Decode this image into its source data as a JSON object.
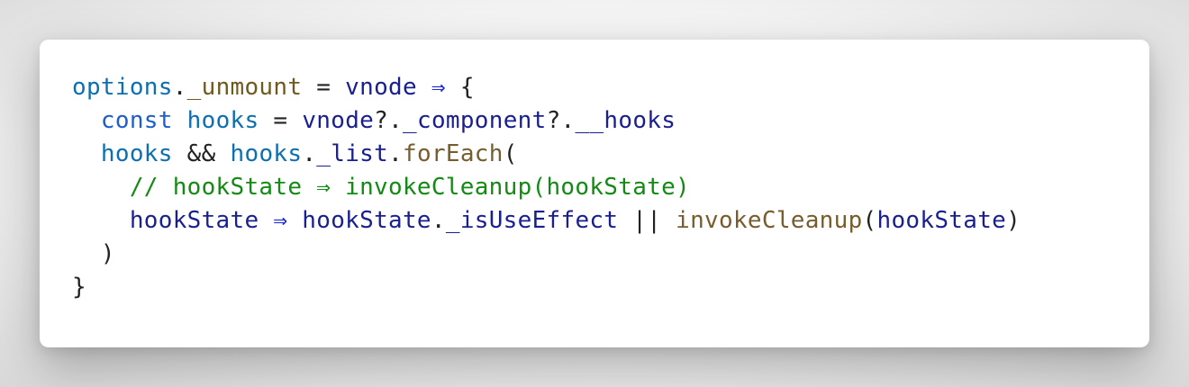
{
  "code": {
    "lines": [
      [
        {
          "text": "options",
          "kind": "var"
        },
        {
          "text": ".",
          "kind": "punct"
        },
        {
          "text": "_unmount",
          "kind": "prop"
        },
        {
          "text": " = ",
          "kind": "punct"
        },
        {
          "text": "vnode",
          "kind": "ident"
        },
        {
          "text": " ⇒ ",
          "kind": "arrow"
        },
        {
          "text": "{",
          "kind": "punct"
        }
      ],
      [
        {
          "text": "  ",
          "kind": "punct"
        },
        {
          "text": "const",
          "kind": "kw"
        },
        {
          "text": " ",
          "kind": "punct"
        },
        {
          "text": "hooks",
          "kind": "var"
        },
        {
          "text": " = ",
          "kind": "punct"
        },
        {
          "text": "vnode",
          "kind": "ident"
        },
        {
          "text": "?.",
          "kind": "punct"
        },
        {
          "text": "_component",
          "kind": "ident"
        },
        {
          "text": "?.",
          "kind": "punct"
        },
        {
          "text": "__hooks",
          "kind": "ident"
        }
      ],
      [
        {
          "text": "  ",
          "kind": "punct"
        },
        {
          "text": "hooks",
          "kind": "var"
        },
        {
          "text": " && ",
          "kind": "punct"
        },
        {
          "text": "hooks",
          "kind": "var"
        },
        {
          "text": ".",
          "kind": "punct"
        },
        {
          "text": "_list",
          "kind": "ident"
        },
        {
          "text": ".",
          "kind": "punct"
        },
        {
          "text": "forEach",
          "kind": "func"
        },
        {
          "text": "(",
          "kind": "punct"
        }
      ],
      [
        {
          "text": "    ",
          "kind": "punct"
        },
        {
          "text": "// hookState ⇒ invokeCleanup(hookState)",
          "kind": "comment"
        }
      ],
      [
        {
          "text": "    ",
          "kind": "punct"
        },
        {
          "text": "hookState",
          "kind": "ident"
        },
        {
          "text": " ⇒ ",
          "kind": "arrow"
        },
        {
          "text": "hookState",
          "kind": "ident"
        },
        {
          "text": ".",
          "kind": "punct"
        },
        {
          "text": "_isUseEffect",
          "kind": "ident"
        },
        {
          "text": " || ",
          "kind": "punct"
        },
        {
          "text": "invokeCleanup",
          "kind": "func"
        },
        {
          "text": "(",
          "kind": "punct"
        },
        {
          "text": "hookState",
          "kind": "ident"
        },
        {
          "text": ")",
          "kind": "punct"
        }
      ],
      [
        {
          "text": "  ",
          "kind": "punct"
        },
        {
          "text": ")",
          "kind": "punct"
        }
      ],
      [
        {
          "text": "}",
          "kind": "punct"
        }
      ]
    ]
  }
}
